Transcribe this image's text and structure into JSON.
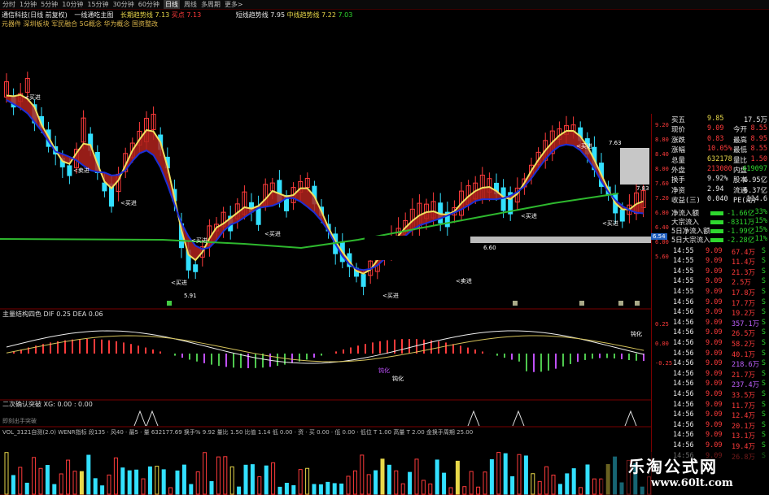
{
  "toolbar": {
    "items": [
      "分时",
      "1分钟",
      "5分钟",
      "10分钟",
      "15分钟",
      "30分钟",
      "60分钟",
      "日线",
      "周线",
      "多周期",
      "更多>"
    ],
    "active_index": 7
  },
  "info": {
    "line1": {
      "stock": "通信科技(日线 前复权)",
      "indicator": "一线通吃主图",
      "mid_label": "长期趋势线",
      "mid_value": "7.13",
      "tag": "买点",
      "tag2": "7.13",
      "right_label": "短线趋势线",
      "right_value": "7.95",
      "right_label2": "中线趋势线",
      "right_value2": "7.22",
      "extra": "7.03"
    },
    "line2": "元器件 深圳板块 军民融合 5G概念 华为概念 国资整改"
  },
  "main_chart": {
    "annotations": [
      "<买进",
      "<卖进",
      "<买进",
      "<买进",
      "<买进",
      "<买进",
      "<买进",
      "<卖进",
      "<买进",
      "<买进",
      "<买进"
    ],
    "low_label": "5.91",
    "mid_label": "6.60",
    "high_label": "7.63",
    "box_label": "7.83",
    "price_ticks": [
      "9.20",
      "8.80",
      "8.40",
      "8.00",
      "7.60",
      "7.20",
      "6.80",
      "6.40",
      "6.00",
      "5.60"
    ],
    "tag_box": "6.54",
    "colors": {
      "up": "#ff3b3b",
      "down": "#33e0ff",
      "fast": "#f0e060",
      "slow": "#1b2fd8",
      "long": "#2eb82e"
    }
  },
  "macd": {
    "title": "主量结构四色 DIF 0.25 DEA 0.06",
    "labels": [
      "钝化",
      "钝化",
      "钝化"
    ],
    "ticks": [
      "0.25",
      "0.00",
      "-0.25"
    ]
  },
  "sub3": {
    "title": "二次确认突破 XG: 0.00 : 0.00",
    "sublabel": "即刻出手突破"
  },
  "vol": {
    "title": "VOL_3121自测(2.0) WENR指标 段135 · 风40 · 最5 · 量 632177.69 换手% 9.92 量比 1.50 比值 1.14 低 0.00 · 资 · 买 0.00 · 低 0.00 · 低位 T 1.00 高量 T 2.00 金换手周期 25.00"
  },
  "right_panel": {
    "top": [
      {
        "l": "买五",
        "v": "9.85",
        "r": "17.5万",
        "vc": "yellow",
        "rc": "white"
      },
      {
        "l": "现价",
        "v": "9.09",
        "m": "今开",
        "r": "8.55",
        "vc": "red",
        "rc": "red"
      },
      {
        "l": "涨跌",
        "v": "0.83",
        "m": "最高",
        "r": "8.95",
        "vc": "red",
        "rc": "red"
      },
      {
        "l": "涨幅",
        "v": "10.05%",
        "m": "最低",
        "r": "8.55",
        "vc": "red",
        "rc": "red"
      },
      {
        "l": "总量",
        "v": "632178",
        "m": "量比",
        "r": "1.50",
        "vc": "yellow",
        "rc": "red"
      },
      {
        "l": "外盘",
        "v": "213080",
        "m": "内盘",
        "r": "419097",
        "vc": "red",
        "rc": "green"
      },
      {
        "l": "换手",
        "v": "9.92%",
        "m": "股本",
        "r": "6.95亿",
        "vc": "white",
        "rc": "white"
      },
      {
        "l": "净资",
        "v": "2.94",
        "m": "流通",
        "r": "6.37亿",
        "vc": "white",
        "rc": "white"
      },
      {
        "l": "收益(三)",
        "v": "0.040",
        "m": "PE(动)",
        "r": "114.6",
        "vc": "white",
        "rc": "white"
      }
    ],
    "flows": [
      {
        "l": "净流入额",
        "v": "-1.66亿",
        "p": "-33%"
      },
      {
        "l": "大宗流入",
        "v": "-8311万",
        "p": "-15%"
      },
      {
        "l": "5日净流入额",
        "v": "-1.99亿",
        "p": "-15%"
      },
      {
        "l": "5日大宗流入",
        "v": "-2.28亿",
        "p": "-11%"
      }
    ],
    "trades": [
      {
        "t": "14:55",
        "p": "9.09",
        "v": "67.4万",
        "s": "S"
      },
      {
        "t": "14:55",
        "p": "9.09",
        "v": "11.4万",
        "s": "S"
      },
      {
        "t": "14:55",
        "p": "9.09",
        "v": "21.3万",
        "s": "S"
      },
      {
        "t": "14:55",
        "p": "9.09",
        "v": "2.5万",
        "s": "S"
      },
      {
        "t": "14:55",
        "p": "9.09",
        "v": "17.8万",
        "s": "S"
      },
      {
        "t": "14:56",
        "p": "9.09",
        "v": "17.7万",
        "s": "S"
      },
      {
        "t": "14:56",
        "p": "9.09",
        "v": "19.2万",
        "s": "S"
      },
      {
        "t": "14:56",
        "p": "9.09",
        "v": "357.1万",
        "s": "S"
      },
      {
        "t": "14:56",
        "p": "9.09",
        "v": "26.5万",
        "s": "S"
      },
      {
        "t": "14:56",
        "p": "9.09",
        "v": "58.2万",
        "s": "S"
      },
      {
        "t": "14:56",
        "p": "9.09",
        "v": "40.1万",
        "s": "S"
      },
      {
        "t": "14:56",
        "p": "9.09",
        "v": "218.6万",
        "s": "S"
      },
      {
        "t": "14:56",
        "p": "9.09",
        "v": "21.7万",
        "s": "S"
      },
      {
        "t": "14:56",
        "p": "9.09",
        "v": "237.4万",
        "s": "S"
      },
      {
        "t": "14:56",
        "p": "9.09",
        "v": "33.5万",
        "s": "S"
      },
      {
        "t": "14:56",
        "p": "9.09",
        "v": "11.7万",
        "s": "S"
      },
      {
        "t": "14:56",
        "p": "9.09",
        "v": "12.4万",
        "s": "S"
      },
      {
        "t": "14:56",
        "p": "9.09",
        "v": "20.1万",
        "s": "S"
      },
      {
        "t": "14:56",
        "p": "9.09",
        "v": "13.1万",
        "s": "S"
      },
      {
        "t": "14:56",
        "p": "9.09",
        "v": "19.4万",
        "s": "S"
      },
      {
        "t": "14:56",
        "p": "9.09",
        "v": "26.8万",
        "s": "S"
      }
    ]
  },
  "watermark": {
    "cn": "乐淘公式网",
    "url": "www.60lt.com"
  }
}
